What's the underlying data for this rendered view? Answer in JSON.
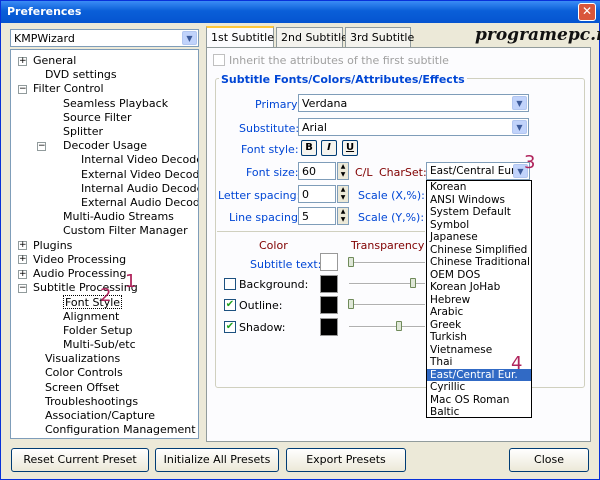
{
  "window": {
    "title": "Preferences"
  },
  "watermark": "programepc.ro",
  "preset": {
    "value": "KMPWizard"
  },
  "tree": [
    {
      "label": "General",
      "exp": "+"
    },
    {
      "label": "DVD settings"
    },
    {
      "label": "Filter Control",
      "exp": "−"
    },
    {
      "label": "Seamless Playback"
    },
    {
      "label": "Source Filter"
    },
    {
      "label": "Splitter"
    },
    {
      "label": "Decoder Usage",
      "exp": "−"
    },
    {
      "label": "Internal Video Decoder"
    },
    {
      "label": "External Video Decoder"
    },
    {
      "label": "Internal Audio Decoder"
    },
    {
      "label": "External Audio Decoder"
    },
    {
      "label": "Multi-Audio Streams"
    },
    {
      "label": "Custom Filter Manager"
    },
    {
      "label": "Plugins",
      "exp": "+"
    },
    {
      "label": "Video Processing",
      "exp": "+"
    },
    {
      "label": "Audio Processing",
      "exp": "+"
    },
    {
      "label": "Subtitle Processing",
      "exp": "−"
    },
    {
      "label": "Font Style"
    },
    {
      "label": "Alignment"
    },
    {
      "label": "Folder Setup"
    },
    {
      "label": "Multi-Sub/etc"
    },
    {
      "label": "Visualizations"
    },
    {
      "label": "Color Controls"
    },
    {
      "label": "Screen Offset"
    },
    {
      "label": "Troubleshootings"
    },
    {
      "label": "Association/Capture"
    },
    {
      "label": "Configuration Management"
    }
  ],
  "tabs": [
    "1st Subtitle",
    "2nd Subtitle",
    "3rd Subtitle"
  ],
  "inherit_label": "Inherit the attributes of the first subtitle",
  "group_title": "Subtitle Fonts/Colors/Attributes/Effects",
  "primary": {
    "label": "Primary:",
    "value": "Verdana"
  },
  "substitute": {
    "label": "Substitute:",
    "value": "Arial"
  },
  "font_style": {
    "label": "Font style:",
    "bold": "B",
    "italic": "I",
    "underline": "U"
  },
  "font_size": {
    "label": "Font size:",
    "value": "60",
    "cl": "C/L"
  },
  "charset": {
    "label": "CharSet:",
    "value": "East/Central Eur."
  },
  "letter_spacing": {
    "label": "Letter spacing:",
    "value": "0",
    "scale_label": "Scale (X,%):"
  },
  "line_spacing": {
    "label": "Line spacing:",
    "value": "5",
    "scale_label": "Scale (Y,%):"
  },
  "color_header": "Color",
  "transparency_header": "Transparency",
  "subtitle_text_label": "Subtitle text:",
  "background": {
    "label": "Background:",
    "checked": false,
    "color": "#000000"
  },
  "outline": {
    "label": "Outline:",
    "checked": true,
    "color": "#000000"
  },
  "shadow": {
    "label": "Shadow:",
    "checked": true,
    "color": "#000000"
  },
  "charset_options": [
    "Korean",
    "ANSI Windows",
    "System Default",
    "Symbol",
    "Japanese",
    "Chinese Simplified",
    "Chinese Traditional",
    "OEM DOS",
    "Korean JoHab",
    "Hebrew",
    "Arabic",
    "Greek",
    "Turkish",
    "Vietnamese",
    "Thai",
    "East/Central Eur.",
    "Cyrillic",
    "Mac OS Roman",
    "Baltic"
  ],
  "charset_selected_index": 15,
  "annotations": [
    "1",
    "2",
    "3",
    "4"
  ],
  "buttons": {
    "reset": "Reset Current Preset",
    "init": "Initialize All Presets",
    "export": "Export Presets",
    "close": "Close"
  }
}
